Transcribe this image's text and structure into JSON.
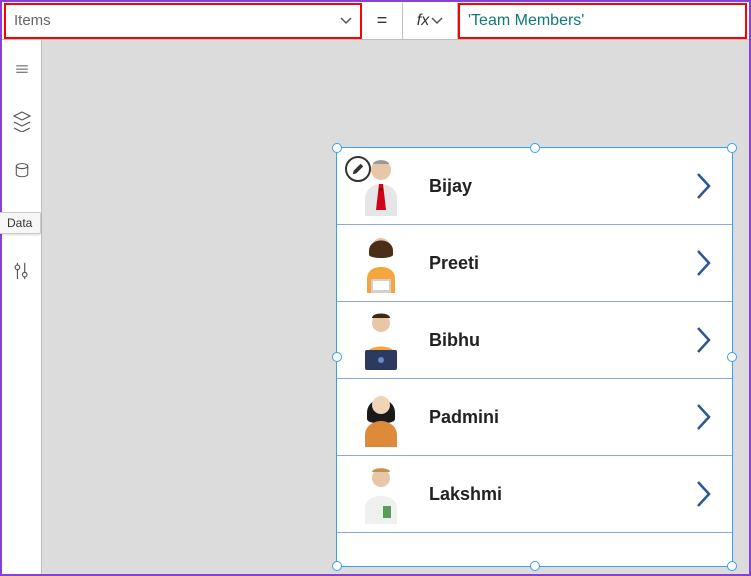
{
  "formula_bar": {
    "property_label": "Items",
    "equals": "=",
    "fx_label": "fx",
    "formula": "'Team Members'"
  },
  "left_rail": {
    "tooltip": "Data"
  },
  "gallery": {
    "items": [
      {
        "name": "Bijay"
      },
      {
        "name": "Preeti"
      },
      {
        "name": "Bibhu"
      },
      {
        "name": "Padmini"
      },
      {
        "name": "Lakshmi"
      }
    ]
  }
}
